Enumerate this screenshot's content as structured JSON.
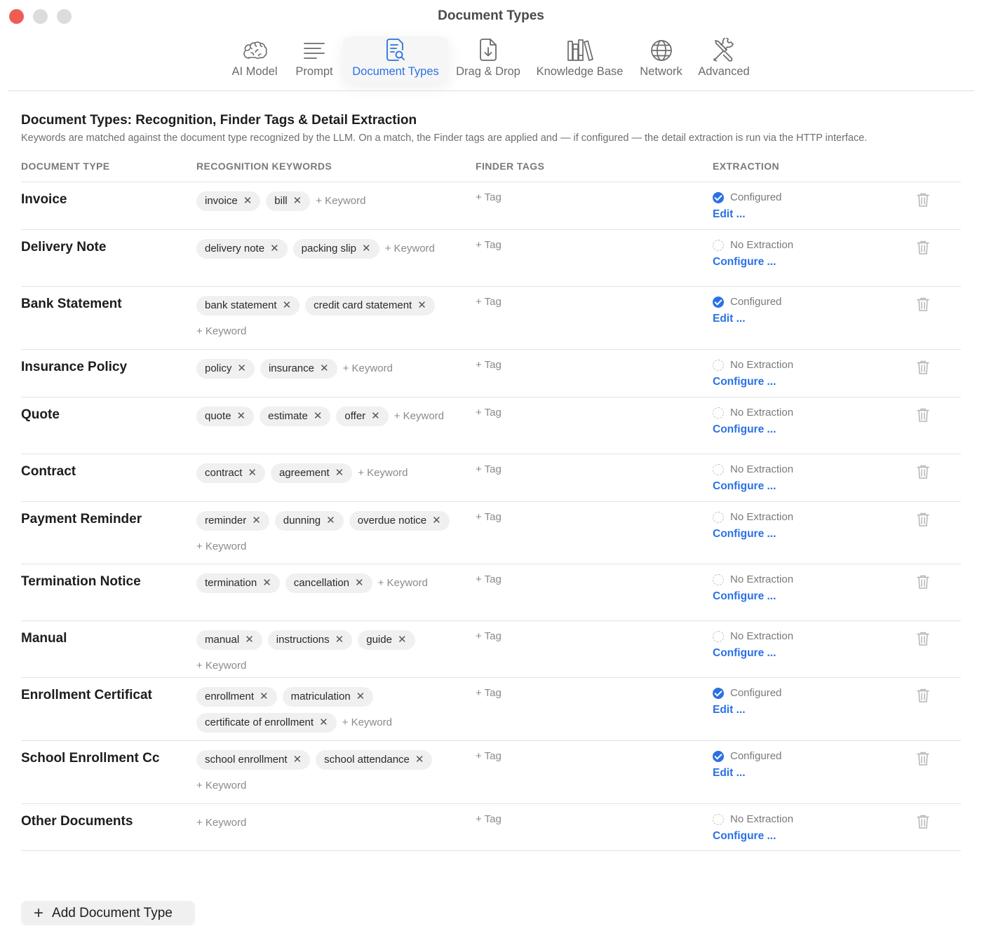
{
  "window": {
    "title": "Document Types"
  },
  "toolbar": {
    "items": [
      {
        "label": "AI Model",
        "icon": "brain-icon"
      },
      {
        "label": "Prompt",
        "icon": "text-lines-icon"
      },
      {
        "label": "Document Types",
        "icon": "document-search-icon",
        "active": true
      },
      {
        "label": "Drag & Drop",
        "icon": "document-download-icon"
      },
      {
        "label": "Knowledge Base",
        "icon": "books-icon"
      },
      {
        "label": "Network",
        "icon": "globe-icon"
      },
      {
        "label": "Advanced",
        "icon": "tools-icon"
      }
    ]
  },
  "header": {
    "title": "Document Types: Recognition, Finder Tags & Detail Extraction",
    "description": "Keywords are matched against the document type recognized by the LLM. On a match, the Finder tags are applied and — if configured — the detail extraction is run via the HTTP interface."
  },
  "columns": {
    "type": "DOCUMENT TYPE",
    "keywords": "RECOGNITION KEYWORDS",
    "tags": "FINDER TAGS",
    "extraction": "EXTRACTION"
  },
  "labels": {
    "add_keyword": "+ Keyword",
    "add_tag": "+ Tag",
    "remove_glyph": "✕"
  },
  "rows": [
    {
      "name": "Invoice",
      "keywords": [
        "invoice",
        "bill"
      ],
      "status": "Configured",
      "configured": true,
      "link": "Edit ..."
    },
    {
      "name": "Delivery Note",
      "keywords": [
        "delivery note",
        "packing slip"
      ],
      "status": "No Extraction",
      "configured": false,
      "link": "Configure ..."
    },
    {
      "name": "Bank Statement",
      "keywords": [
        "bank statement",
        "credit card statement"
      ],
      "status": "Configured",
      "configured": true,
      "link": "Edit ..."
    },
    {
      "name": "Insurance Policy",
      "keywords": [
        "policy",
        "insurance"
      ],
      "status": "No Extraction",
      "configured": false,
      "link": "Configure ..."
    },
    {
      "name": "Quote",
      "keywords": [
        "quote",
        "estimate",
        "offer"
      ],
      "status": "No Extraction",
      "configured": false,
      "link": "Configure ..."
    },
    {
      "name": "Contract",
      "keywords": [
        "contract",
        "agreement"
      ],
      "status": "No Extraction",
      "configured": false,
      "link": "Configure ..."
    },
    {
      "name": "Payment Reminder",
      "keywords": [
        "reminder",
        "dunning",
        "overdue notice"
      ],
      "status": "No Extraction",
      "configured": false,
      "link": "Configure ..."
    },
    {
      "name": "Termination Notice",
      "keywords": [
        "termination",
        "cancellation"
      ],
      "status": "No Extraction",
      "configured": false,
      "link": "Configure ..."
    },
    {
      "name": "Manual",
      "keywords": [
        "manual",
        "instructions",
        "guide"
      ],
      "status": "No Extraction",
      "configured": false,
      "link": "Configure ..."
    },
    {
      "name": "Enrollment Certificat",
      "keywords": [
        "enrollment",
        "matriculation",
        "certificate of enrollment"
      ],
      "status": "Configured",
      "configured": true,
      "link": "Edit ..."
    },
    {
      "name": "School Enrollment Cc",
      "keywords": [
        "school enrollment",
        "school attendance"
      ],
      "status": "Configured",
      "configured": true,
      "link": "Edit ..."
    },
    {
      "name": "Other Documents",
      "keywords": [],
      "status": "No Extraction",
      "configured": false,
      "link": "Configure ..."
    }
  ],
  "footer": {
    "add_button": "Add Document Type"
  },
  "colors": {
    "accent": "#2a71e4",
    "close": "#ee5d52"
  }
}
